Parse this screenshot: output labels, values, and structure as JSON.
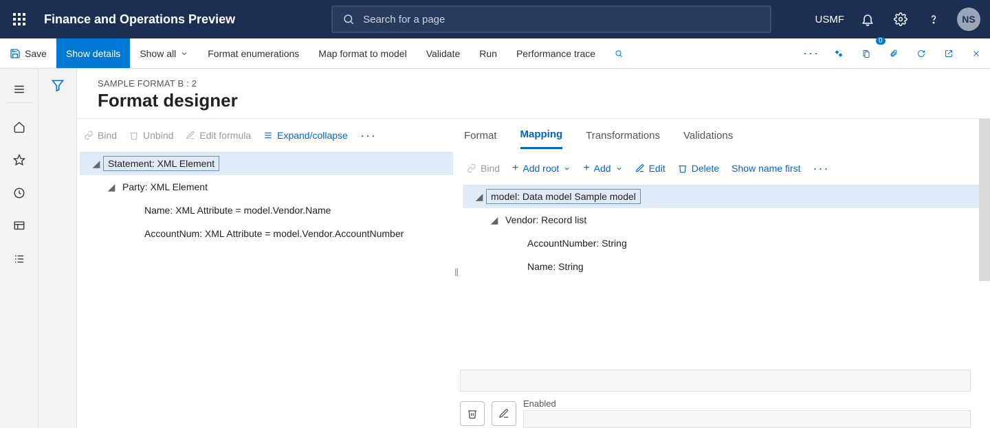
{
  "header": {
    "app_title": "Finance and Operations Preview",
    "search_placeholder": "Search for a page",
    "company": "USMF",
    "avatar": "NS"
  },
  "actionpane": {
    "save": "Save",
    "show_details": "Show details",
    "show_all": "Show all",
    "format_enum": "Format enumerations",
    "map_format": "Map format to model",
    "validate": "Validate",
    "run": "Run",
    "perf_trace": "Performance trace",
    "badge_count": "0"
  },
  "page": {
    "breadcrumb": "SAMPLE FORMAT B : 2",
    "title": "Format designer"
  },
  "left_toolbar": {
    "bind": "Bind",
    "unbind": "Unbind",
    "edit_formula": "Edit formula",
    "expand_collapse": "Expand/collapse"
  },
  "left_tree": {
    "n0": "Statement: XML Element",
    "n1": "Party: XML Element",
    "n2": "Name: XML Attribute = model.Vendor.Name",
    "n3": "AccountNum: XML Attribute = model.Vendor.AccountNumber"
  },
  "tabs": {
    "format": "Format",
    "mapping": "Mapping",
    "transformations": "Transformations",
    "validations": "Validations"
  },
  "right_toolbar": {
    "bind": "Bind",
    "add_root": "Add root",
    "add": "Add",
    "edit": "Edit",
    "delete": "Delete",
    "show_name_first": "Show name first"
  },
  "right_tree": {
    "n0": "model: Data model Sample model",
    "n1": "Vendor: Record list",
    "n2": "AccountNumber: String",
    "n3": "Name: String"
  },
  "props": {
    "enabled": "Enabled"
  }
}
